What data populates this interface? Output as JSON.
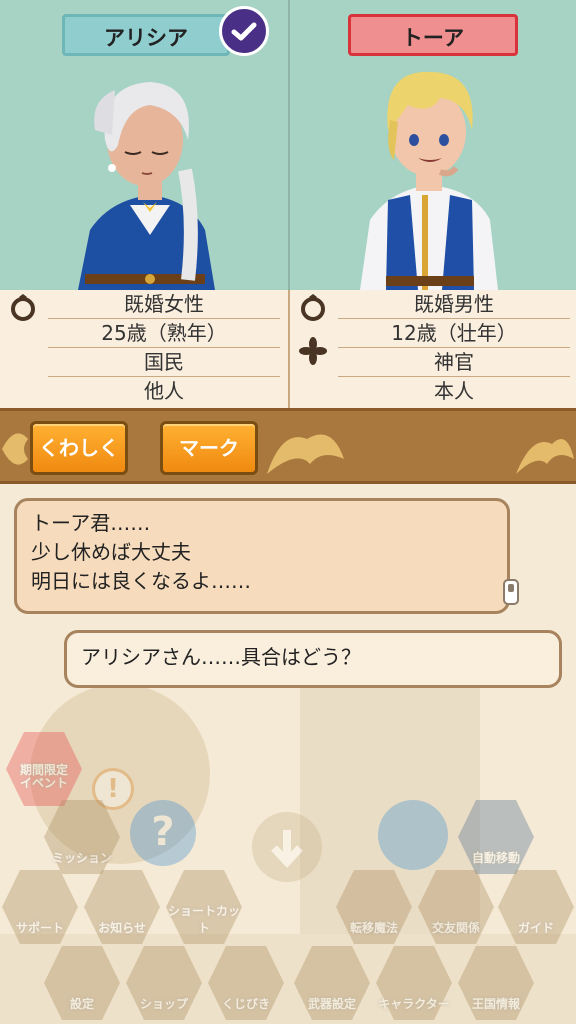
{
  "left_character": {
    "name": "アリシア",
    "rows": [
      "既婚女性",
      "25歳（熟年）",
      "国民",
      "他人"
    ]
  },
  "right_character": {
    "name": "トーア",
    "rows": [
      "既婚男性",
      "12歳（壮年）",
      "神官",
      "本人"
    ]
  },
  "buttons": {
    "details": "くわしく",
    "mark": "マーク"
  },
  "dialogue": {
    "line1": "トーア君……",
    "line2": "少し休めば大丈夫",
    "line3": "明日には良くなるよ……",
    "reply": "アリシアさん……具合はどう？"
  },
  "menu": {
    "limited_event": "期間限定\nイベント",
    "mission": "ミッション",
    "auto_move": "自動移動",
    "support": "サポート",
    "notice": "お知らせ",
    "shortcut": "ショートカット",
    "transfer": "転移魔法",
    "friends": "交友関係",
    "guide": "ガイド",
    "settings": "設定",
    "shop": "ショップ",
    "lottery": "くじびき",
    "weapon": "武器設定",
    "character": "キャラクター",
    "kingdom": "王国情報"
  },
  "colors": {
    "portrait_bg": "#a6d3c4",
    "banner": "#a9783f",
    "button_orange": "#f08a10",
    "bubble_fill": "#f6dcbd",
    "check_badge": "#4a2f87",
    "name_plate_red_border": "#d8333b"
  }
}
